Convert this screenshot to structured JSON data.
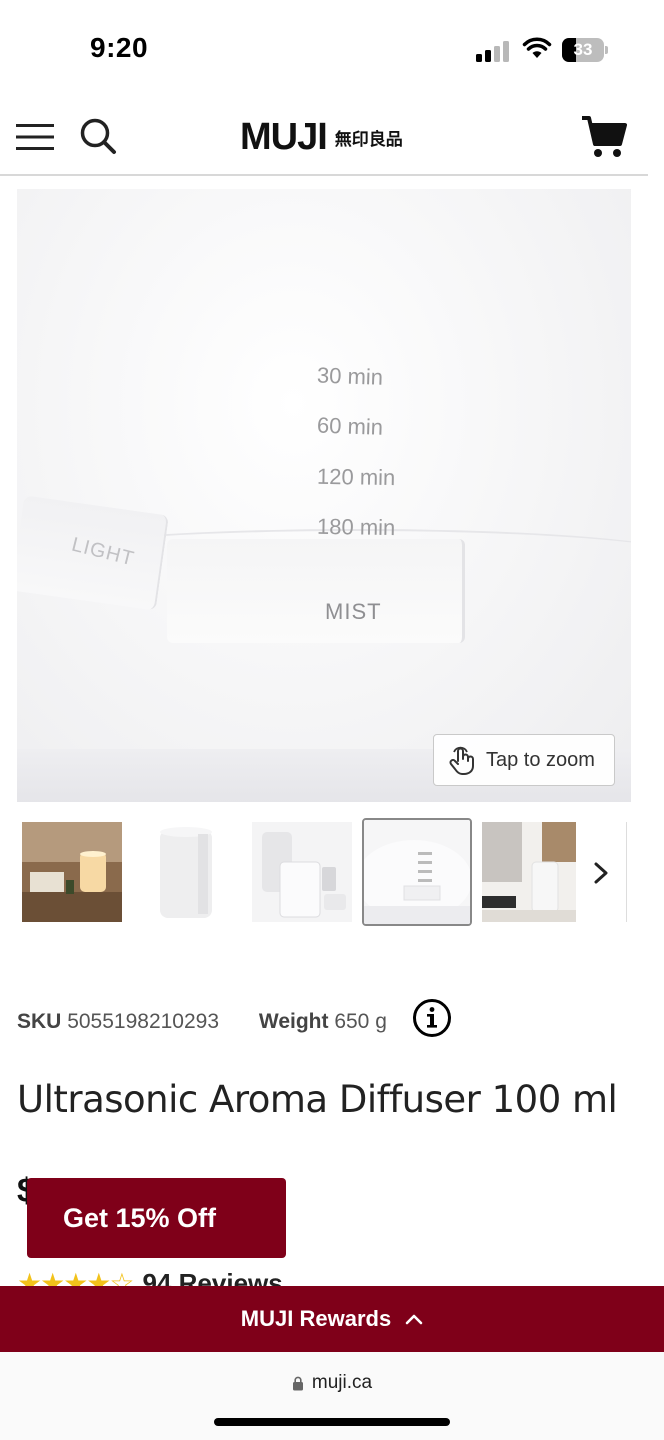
{
  "status_bar": {
    "time": "9:20",
    "battery_percent": "33",
    "battery_level": 0.33,
    "icons": [
      "signal-icon",
      "wifi-icon",
      "battery-icon"
    ]
  },
  "header": {
    "logo_text": "MUJI",
    "logo_cjk": "無印良品",
    "icons": [
      "menu-icon",
      "search-icon",
      "cart-icon"
    ]
  },
  "gallery": {
    "main_image_text": {
      "timers": [
        "30 min",
        "60 min",
        "120 min",
        "180 min"
      ],
      "light_button": "LIGHT",
      "mist_button": "MIST"
    },
    "zoom_hint": "Tap to zoom",
    "thumbnail_count": 5,
    "selected_thumbnail": 4,
    "next_icon": "chevron-right-icon"
  },
  "product": {
    "sku_label": "SKU",
    "sku": "5055198210293",
    "weight_label": "Weight",
    "weight": "650 g",
    "title": "Ultrasonic Aroma Diffuser 100 ml",
    "price_partial": "$",
    "rating": 4.5,
    "stars": "★★★★☆",
    "review_count": "94 Reviews"
  },
  "promo": {
    "button_label": "Get 15% Off"
  },
  "rewards": {
    "label": "MUJI Rewards"
  },
  "browser": {
    "url": "muji.ca"
  },
  "colors": {
    "brand": "#7f0019",
    "star": "#f2c21b"
  }
}
